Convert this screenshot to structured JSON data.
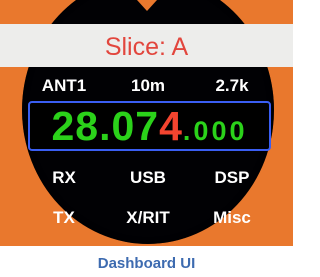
{
  "colors": {
    "bezel": "#e9782d",
    "screen": "#010104",
    "title_band": "#ededeb",
    "title_text": "#e2463d",
    "frequency_green": "#2bd21a",
    "frequency_red": "#f4442f",
    "frequency_border": "#3a5ef2",
    "caption": "#3d6bb0"
  },
  "header": {
    "slice_label": "Slice: A"
  },
  "info": {
    "antenna": "ANT1",
    "band": "10m",
    "filter_width": "2.7k"
  },
  "frequency": {
    "main": "28.07",
    "accent_digit": "4",
    "sub": ".000"
  },
  "buttons_row1": [
    "RX",
    "USB",
    "DSP"
  ],
  "buttons_row2": [
    "TX",
    "X/RIT",
    "Misc"
  ],
  "caption": "Dashboard UI"
}
